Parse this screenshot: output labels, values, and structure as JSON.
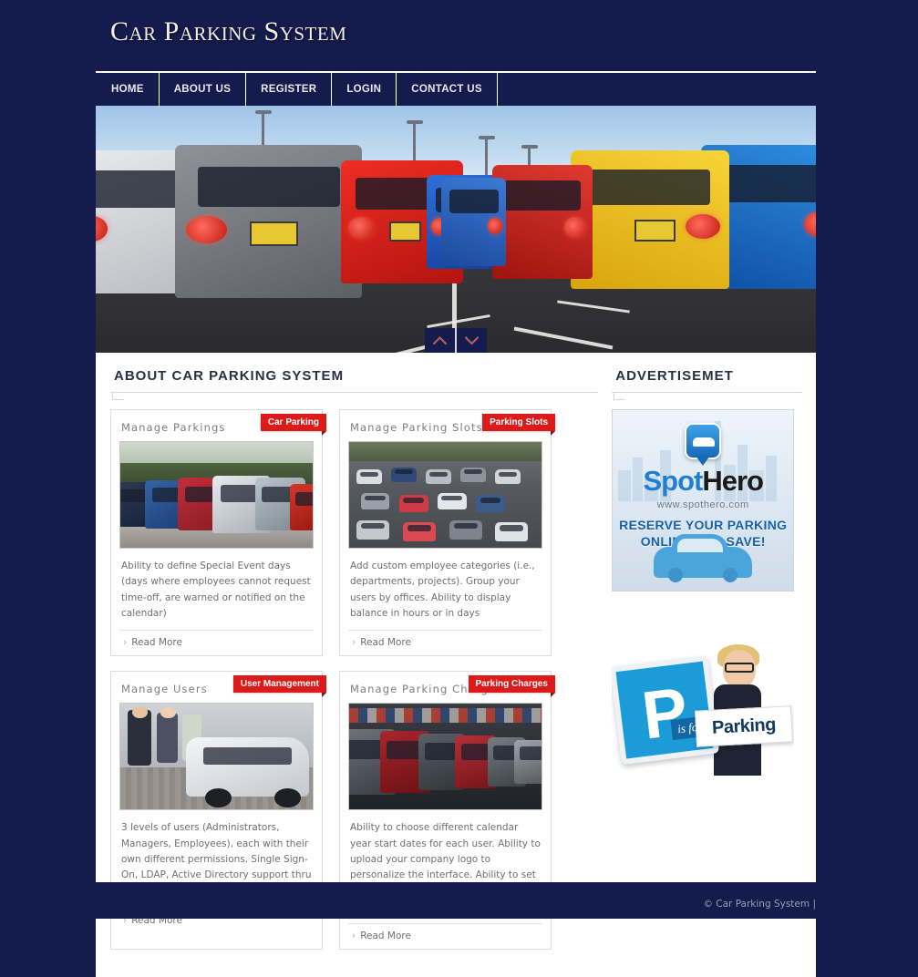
{
  "site": {
    "title": "Car Parking System",
    "background_color": "#141b4d",
    "accent_color": "#dd1a1a"
  },
  "nav": {
    "items": [
      {
        "label": "HOME"
      },
      {
        "label": "ABOUT US"
      },
      {
        "label": "REGISTER"
      },
      {
        "label": "LOGIN"
      },
      {
        "label": "CONTACT US"
      }
    ]
  },
  "hero": {
    "alt": "Row of parked cars in a parking lot receding to vanishing point",
    "prev_icon": "chevron-up-icon",
    "next_icon": "chevron-down-icon"
  },
  "main": {
    "section_title": "ABOUT CAR PARKING SYSTEM",
    "cards": [
      {
        "heading": "Manage Parkings",
        "ribbon": "Car Parking",
        "description": "Ability to define Special Event days (days where employees cannot request time-off, are warned or notified on the calendar)",
        "read_more": "Read More"
      },
      {
        "heading": "Manage Parking Slots",
        "ribbon": "Parking Slots",
        "description": "Add custom employee categories (i.e., departments, projects). Group your users by offices. Ability to display balance in hours or in days",
        "read_more": "Read More"
      },
      {
        "heading": "Manage Users",
        "ribbon": "User Management",
        "description": "3 levels of users (Administrators, Managers, Employees), each with their own different permissions. Single Sign-On, LDAP, Active Directory support thru OneLogin.comNew",
        "read_more": "Read More"
      },
      {
        "heading": "Manage Parking Charges",
        "ribbon": "Parking Charges",
        "description": "Ability to choose different calendar year start dates for each user. Ability to upload your company logo to personalize the interface. Ability to set time-off, pending request and holiday reminders",
        "read_more": "Read More"
      }
    ]
  },
  "sidebar": {
    "section_title": "ADVERTISEMET",
    "ads": [
      {
        "brand_part1": "Spot",
        "brand_part2": "Hero",
        "url": "www.spothero.com",
        "line1": "RESERVE YOUR PARKING",
        "line2": "ONLINE AND SAVE!"
      },
      {
        "sign_letter": "P",
        "tagline": "is for...",
        "word": "Parking"
      }
    ]
  },
  "footer": {
    "copyright": "© Car Parking System  |"
  }
}
